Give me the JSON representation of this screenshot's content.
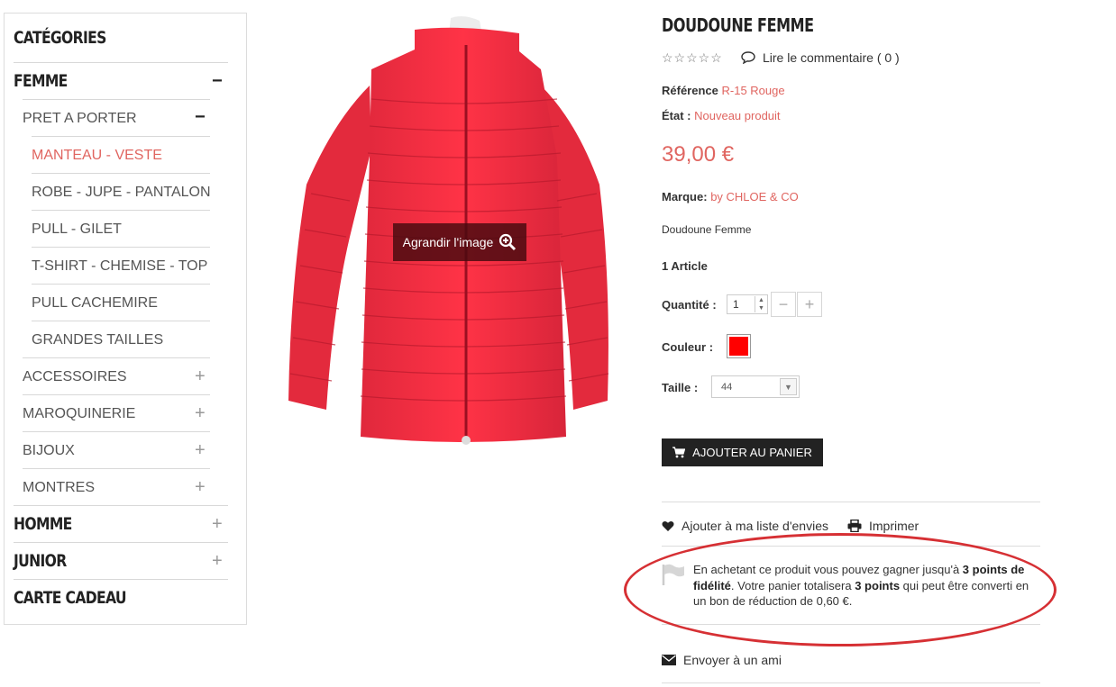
{
  "sidebar": {
    "title": "CATÉGORIES",
    "femme": {
      "label": "FEMME",
      "toggle": "−"
    },
    "pret": {
      "label": "PRET A PORTER",
      "toggle": "−"
    },
    "subitems": [
      "MANTEAU - VESTE",
      "ROBE - JUPE - PANTALON",
      "PULL - GILET",
      "T-SHIRT - CHEMISE - TOP",
      "PULL CACHEMIRE",
      "GRANDES TAILLES"
    ],
    "groups": [
      {
        "label": "ACCESSOIRES",
        "toggle": "+"
      },
      {
        "label": "MAROQUINERIE",
        "toggle": "+"
      },
      {
        "label": "BIJOUX",
        "toggle": "+"
      },
      {
        "label": "MONTRES",
        "toggle": "+"
      }
    ],
    "homme": {
      "label": "HOMME",
      "toggle": "+"
    },
    "junior": {
      "label": "JUNIOR",
      "toggle": "+"
    },
    "cadeau": {
      "label": "CARTE CADEAU"
    }
  },
  "image": {
    "zoom_label": "Agrandir l'image"
  },
  "product": {
    "title": "DOUDOUNE FEMME",
    "stars": "☆☆☆☆☆",
    "review_link": "Lire le commentaire ( 0 )",
    "reference_label": "Référence",
    "reference_value": "R-15 Rouge",
    "etat_label": "État :",
    "etat_value": "Nouveau produit",
    "price": "39,00 €",
    "marque_label": "Marque:",
    "marque_value": "by CHLOE & CO",
    "description": "Doudoune Femme",
    "stock": "1 Article",
    "quantity_label": "Quantité :",
    "quantity_value": "1",
    "couleur_label": "Couleur :",
    "color_hex": "#ff0000",
    "taille_label": "Taille :",
    "taille_value": "44",
    "add_to_cart": "AJOUTER AU PANIER"
  },
  "actions": {
    "wishlist": "Ajouter à ma liste d'envies",
    "print": "Imprimer",
    "send_friend": "Envoyer à un ami"
  },
  "loyalty": {
    "t1": "En achetant ce produit vous pouvez gagner jusqu'à ",
    "b1": "3 points de fidélité",
    "t2": ". Votre panier totalisera ",
    "b2": "3 points",
    "t3": " qui peut être converti en un bon de réduction de 0,60 €."
  }
}
